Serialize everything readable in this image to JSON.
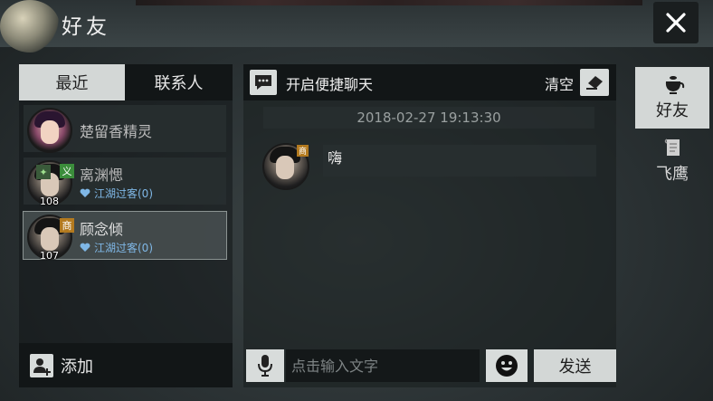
{
  "header": {
    "title": "好友"
  },
  "tabs": {
    "recent": "最近",
    "contacts": "联系人"
  },
  "friends": [
    {
      "name": "楚留香精灵",
      "level": "",
      "relation": "",
      "badge": ""
    },
    {
      "name": "离渊愢",
      "level": "108",
      "relation": "江湖过客(0)",
      "badge": "义"
    },
    {
      "name": "顾念倾",
      "level": "107",
      "relation": "江湖过客(0)",
      "badge": "商"
    }
  ],
  "left_footer": {
    "add_label": "添加"
  },
  "chat": {
    "quick_chat_label": "开启便捷聊天",
    "clear_label": "清空",
    "timestamp": "2018-02-27 19:13:30",
    "messages": [
      {
        "text": "嗨",
        "badge": "商"
      }
    ],
    "input_placeholder": "点击输入文字",
    "send_label": "发送"
  },
  "side_tabs": {
    "friends": "好友",
    "mail": "飞鹰"
  },
  "colors": {
    "accent_light": "#d3d7d6",
    "relation_blue": "#7fb7e6",
    "badge_merchant": "#b37a1f",
    "badge_yi": "#3b8d3b"
  }
}
